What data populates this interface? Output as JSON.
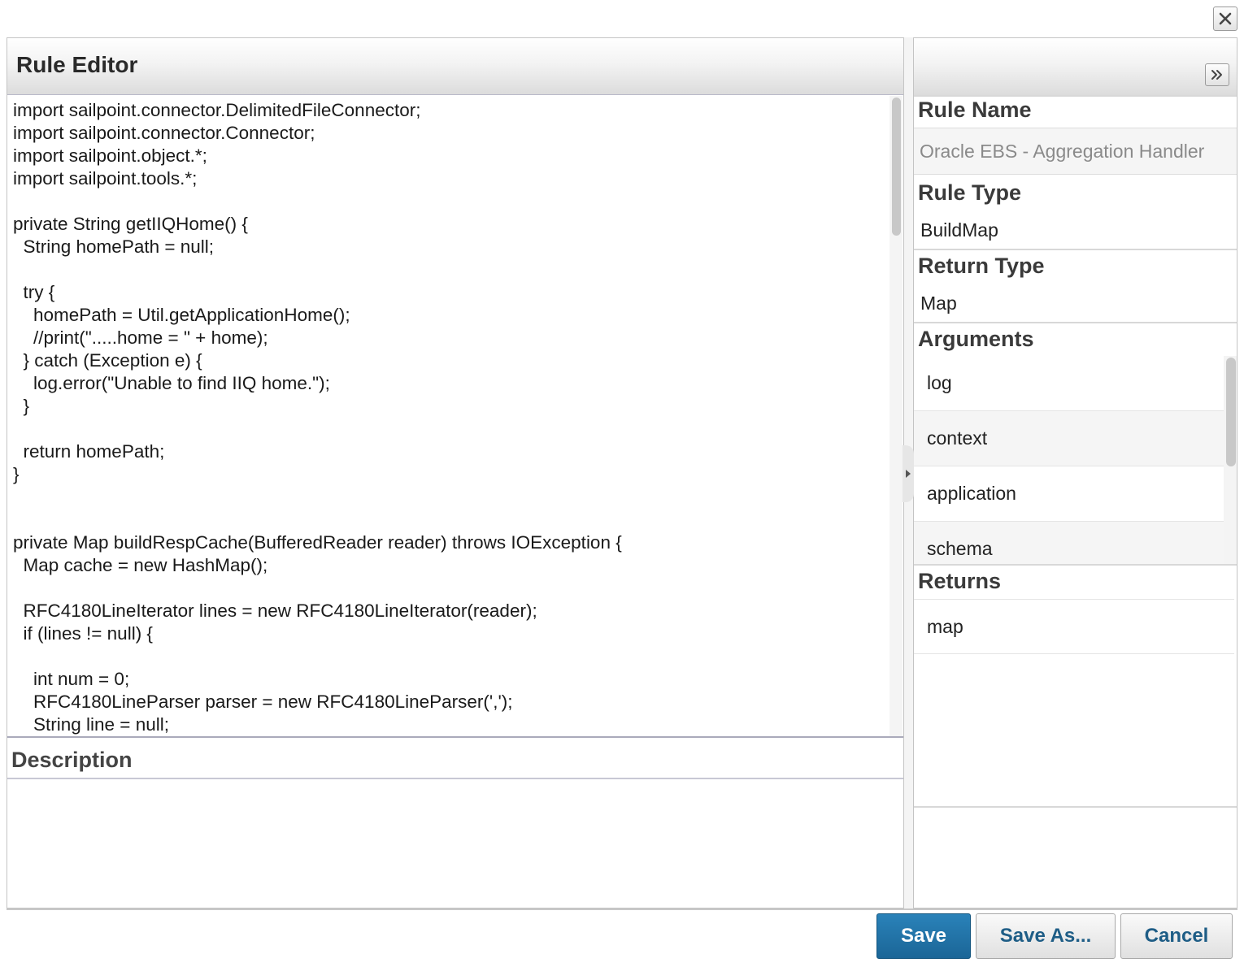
{
  "editor": {
    "title": "Rule Editor",
    "code_lines": [
      "import sailpoint.connector.DelimitedFileConnector;",
      "import sailpoint.connector.Connector;",
      "import sailpoint.object.*;",
      "import sailpoint.tools.*;",
      "",
      "private String getIIQHome() {",
      "  String homePath = null;",
      "",
      "  try {",
      "    homePath = Util.getApplicationHome();",
      "    //print(\".....home = \" + home);",
      "  } catch (Exception e) {",
      "    log.error(\"Unable to find IIQ home.\");",
      "  }",
      "",
      "  return homePath;",
      "}",
      "",
      "",
      "private Map buildRespCache(BufferedReader reader) throws IOException {",
      "  Map cache = new HashMap();",
      "",
      "  RFC4180LineIterator lines = new RFC4180LineIterator(reader);",
      "  if (lines != null) {",
      "",
      "    int num = 0;",
      "    RFC4180LineParser parser = new RFC4180LineParser(',');",
      "    String line = null;"
    ],
    "description_label": "Description",
    "description_value": ""
  },
  "details": {
    "rule_name_label": "Rule Name",
    "rule_name_value": "Oracle EBS - Aggregation Handler",
    "rule_type_label": "Rule Type",
    "rule_type_value": "BuildMap",
    "return_type_label": "Return Type",
    "return_type_value": "Map",
    "arguments_label": "Arguments",
    "arguments": [
      "log",
      "context",
      "application",
      "schema"
    ],
    "returns_label": "Returns",
    "returns": [
      "map"
    ]
  },
  "icons": {
    "close": "close-icon",
    "expand": "double-chevron-right-icon",
    "splitter": "caret-right-icon"
  },
  "buttons": {
    "save": "Save",
    "save_as": "Save As...",
    "cancel": "Cancel"
  },
  "colors": {
    "primary_button": "#1f6fa3",
    "link_text": "#1e5d86"
  }
}
